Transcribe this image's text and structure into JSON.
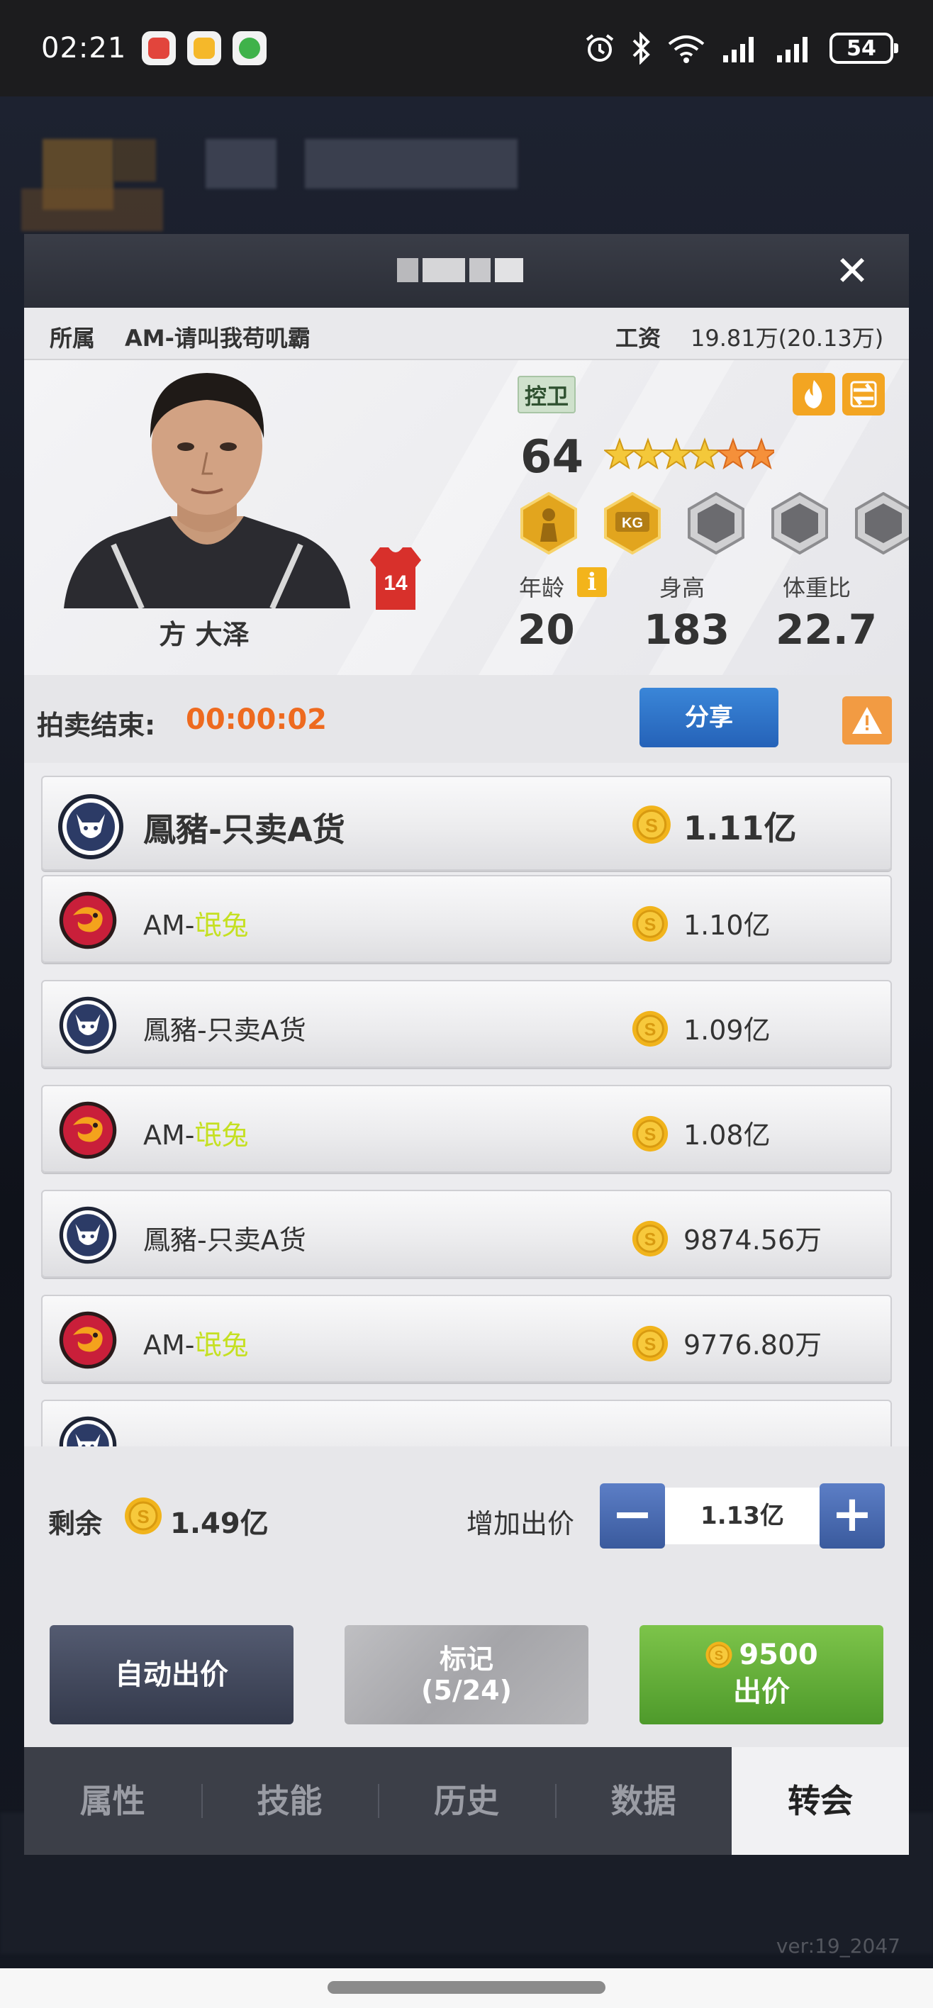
{
  "status_bar": {
    "time": "02:21",
    "battery": "54",
    "notification_icons": [
      "red-app-icon",
      "yellow-mail-icon",
      "green-message-icon"
    ],
    "system_icons": [
      "alarm-icon",
      "bluetooth-icon",
      "wifi-icon",
      "signal-icon",
      "signal-icon"
    ]
  },
  "dialog": {
    "title_censored": true,
    "info": {
      "team_label": "所属",
      "team_value": "AM-请叫我苟叽霸",
      "salary_label": "工资",
      "salary_value": "19.81万(20.13万)"
    },
    "player": {
      "name": "方 大泽",
      "jersey_number": "14",
      "position": "控卫",
      "overall": "64",
      "stars_gold": 4,
      "stars_orange": 2,
      "badges": [
        "player-badge-icon",
        "kg-badge-icon",
        "locked-badge-icon",
        "locked-badge-icon",
        "locked-badge-icon"
      ],
      "attrs": [
        {
          "label": "年龄",
          "value": "20"
        },
        {
          "label": "身高",
          "value": "183"
        },
        {
          "label": "体重比",
          "value": "22.7"
        }
      ]
    },
    "auction": {
      "label": "拍卖结束:",
      "timer": "00:00:02",
      "share_label": "分享"
    },
    "bids": [
      {
        "team_prefix": "鳳豬-只卖A货",
        "team_highlight": "",
        "amount": "1.11亿",
        "logo": "pig"
      },
      {
        "team_prefix": "AM-",
        "team_highlight": "氓兔",
        "amount": "1.10亿",
        "logo": "dragon"
      },
      {
        "team_prefix": "鳳豬-只卖A货",
        "team_highlight": "",
        "amount": "1.09亿",
        "logo": "pig"
      },
      {
        "team_prefix": "AM-",
        "team_highlight": "氓兔",
        "amount": "1.08亿",
        "logo": "dragon"
      },
      {
        "team_prefix": "鳳豬-只卖A货",
        "team_highlight": "",
        "amount": "9874.56万",
        "logo": "pig"
      },
      {
        "team_prefix": "AM-",
        "team_highlight": "氓兔",
        "amount": "9776.80万",
        "logo": "dragon"
      }
    ],
    "bottom": {
      "remain_label": "剩余",
      "remain_value": "1.49亿",
      "add_bid_label": "增加出价",
      "stepper_value": "1.13亿",
      "auto_bid_label": "自动出价",
      "mark_label": "标记",
      "mark_count": "(5/24)",
      "bid_cost": "9500",
      "bid_label": "出价"
    },
    "tabs": [
      "属性",
      "技能",
      "历史",
      "数据",
      "转会"
    ],
    "active_tab": "转会"
  },
  "version": "ver:19_2047",
  "colors": {
    "timer": "#ee6a1f",
    "share_button": "#2f74c8",
    "bid_button": "#62ae38",
    "highlight_text": "#c5e022",
    "header": "#2f323b"
  }
}
